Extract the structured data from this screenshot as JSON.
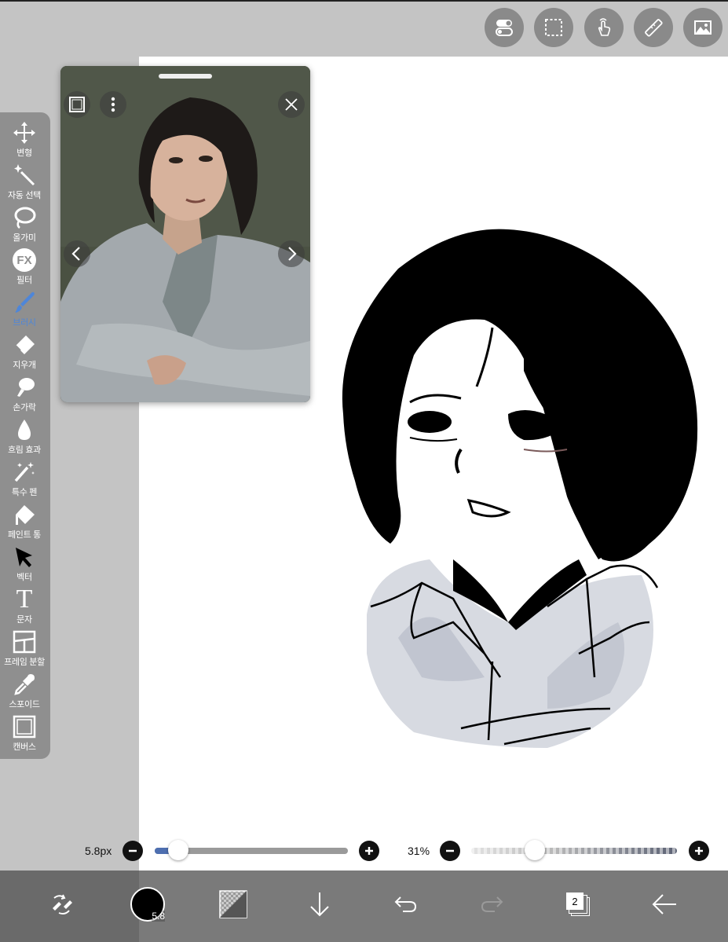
{
  "toolbar": {
    "tools": [
      {
        "label": "변형",
        "icon": "move-icon"
      },
      {
        "label": "자동 선택",
        "icon": "magic-wand-icon"
      },
      {
        "label": "올가미",
        "icon": "lasso-icon"
      },
      {
        "label": "필터",
        "icon": "fx-filter-icon",
        "fx_text": "FX"
      },
      {
        "label": "브러시",
        "icon": "brush-icon",
        "active": true
      },
      {
        "label": "지우개",
        "icon": "eraser-icon"
      },
      {
        "label": "손가락",
        "icon": "smudge-finger-icon"
      },
      {
        "label": "흐림 효과",
        "icon": "blur-drop-icon"
      },
      {
        "label": "특수 펜",
        "icon": "special-pen-icon"
      },
      {
        "label": "페인트 통",
        "icon": "paint-bucket-icon"
      },
      {
        "label": "벡터",
        "icon": "vector-cursor-icon"
      },
      {
        "label": "문자",
        "icon": "text-tool-icon",
        "glyph": "T"
      },
      {
        "label": "프레임 분할",
        "icon": "frame-divider-icon"
      },
      {
        "label": "스포이드",
        "icon": "eyedropper-icon"
      },
      {
        "label": "캔버스",
        "icon": "canvas-icon"
      }
    ],
    "active_color": "#4e86d9"
  },
  "topbar": {
    "buttons": [
      "toggle-settings-icon",
      "selection-icon",
      "touch-gesture-icon",
      "ruler-icon",
      "image-icon"
    ]
  },
  "reference_window": {
    "buttons": [
      "reference-mode-icon",
      "more-options-icon",
      "close-icon",
      "previous-icon",
      "next-icon"
    ]
  },
  "brush_size": {
    "label": "5.8px",
    "level": 0.07,
    "color_chip_label": "5.8"
  },
  "brush_opacity": {
    "label": "31%",
    "level": 0.31
  },
  "bottombar": {
    "layers_count": "2",
    "buttons": [
      "swap-tool-icon",
      "color-picker-chip",
      "material-pattern-icon",
      "download-arrow-icon",
      "undo-icon",
      "redo-icon",
      "layers-icon",
      "back-arrow-icon"
    ]
  }
}
